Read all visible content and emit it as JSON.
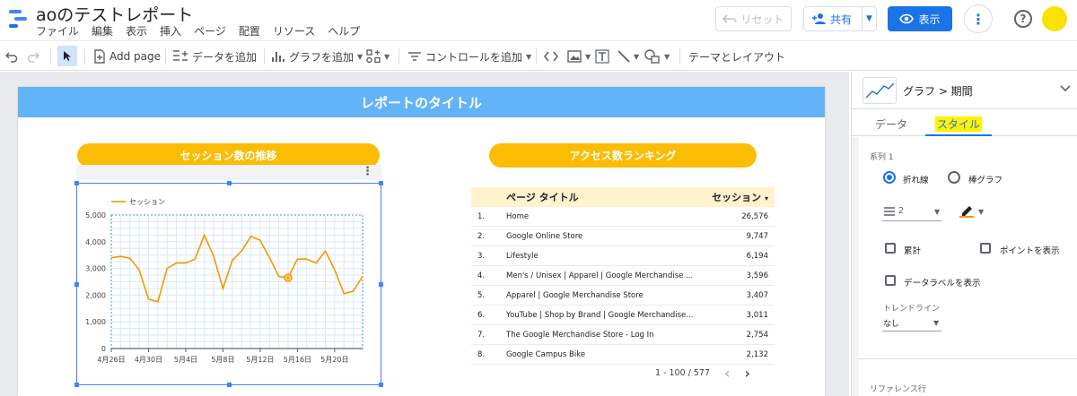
{
  "app": {
    "doc_title": "aoのテストレポート",
    "menu": [
      "ファイル",
      "編集",
      "表示",
      "挿入",
      "ページ",
      "配置",
      "リソース",
      "ヘルプ"
    ],
    "reset_label": "リセット",
    "share_label": "共有",
    "view_label": "表示",
    "help_glyph": "?",
    "avatar_color": "#f9e200"
  },
  "toolbar": {
    "add_page": "Add page",
    "add_data": "データを追加",
    "add_chart": "グラフを追加",
    "add_control": "コントロールを追加",
    "theme_layout": "テーマとレイアウト"
  },
  "report": {
    "banner_title": "レポートのタイトル",
    "chart_header": "セッション数の推移",
    "table_header": "アクセス数ランキング",
    "banner_color": "#62b3f7",
    "accent_color": "#fbbc04"
  },
  "chart_data": {
    "type": "line",
    "legend": "セッション",
    "x_ticks": [
      "4月26日",
      "4月30日",
      "5月4日",
      "5月8日",
      "5月12日",
      "5月16日",
      "5月20日"
    ],
    "y_ticks": [
      "0",
      "1,000",
      "2,000",
      "3,000",
      "4,000",
      "5,000"
    ],
    "ylim": [
      0,
      5000
    ],
    "x": [
      "4月26日",
      "4月27日",
      "4月28日",
      "4月29日",
      "4月30日",
      "5月1日",
      "5月2日",
      "5月3日",
      "5月4日",
      "5月5日",
      "5月6日",
      "5月7日",
      "5月8日",
      "5月9日",
      "5月10日",
      "5月11日",
      "5月12日",
      "5月13日",
      "5月14日",
      "5月15日",
      "5月16日",
      "5月17日",
      "5月18日",
      "5月19日",
      "5月20日",
      "5月21日",
      "5月22日",
      "5月23日"
    ],
    "values": [
      3400,
      3450,
      3380,
      2950,
      1850,
      1750,
      3000,
      3200,
      3200,
      3350,
      4250,
      3450,
      2250,
      3300,
      3650,
      4200,
      4050,
      3400,
      2700,
      2650,
      3350,
      3350,
      3200,
      3650,
      2950,
      2050,
      2150,
      2700
    ],
    "highlight_index": 19,
    "line_color": "#f29900",
    "grid": true
  },
  "table": {
    "col_title": "ページ タイトル",
    "col_value": "セッション",
    "sort_glyph": "▾",
    "rows": [
      {
        "rank": "1.",
        "title": "Home",
        "value": "26,576"
      },
      {
        "rank": "2.",
        "title": "Google Online Store",
        "value": "9,747"
      },
      {
        "rank": "3.",
        "title": "Lifestyle",
        "value": "6,194"
      },
      {
        "rank": "4.",
        "title": "Men's / Unisex | Apparel | Google Merchandise ...",
        "value": "3,596"
      },
      {
        "rank": "5.",
        "title": "Apparel | Google Merchandise Store",
        "value": "3,407"
      },
      {
        "rank": "6.",
        "title": "YouTube | Shop by Brand | Google Merchandise...",
        "value": "3,011"
      },
      {
        "rank": "7.",
        "title": "The Google Merchandise Store - Log In",
        "value": "2,754"
      },
      {
        "rank": "8.",
        "title": "Google Campus Bike",
        "value": "2,132"
      }
    ],
    "pager_text": "1 - 100 / 577",
    "prev_glyph": "‹",
    "next_glyph": "›"
  },
  "panel": {
    "breadcrumb": "グラフ > 期間",
    "tab_data": "データ",
    "tab_style": "スタイル",
    "series_label": "系列 1",
    "opt_line": "折れ線",
    "opt_bar": "棒グラフ",
    "line_weight": "2",
    "cumulative": "累計",
    "show_points": "ポイントを表示",
    "show_data_labels": "データラベルを表示",
    "trendline_label": "トレンドライン",
    "trendline_value": "なし",
    "reference_line": "リファレンス行"
  }
}
